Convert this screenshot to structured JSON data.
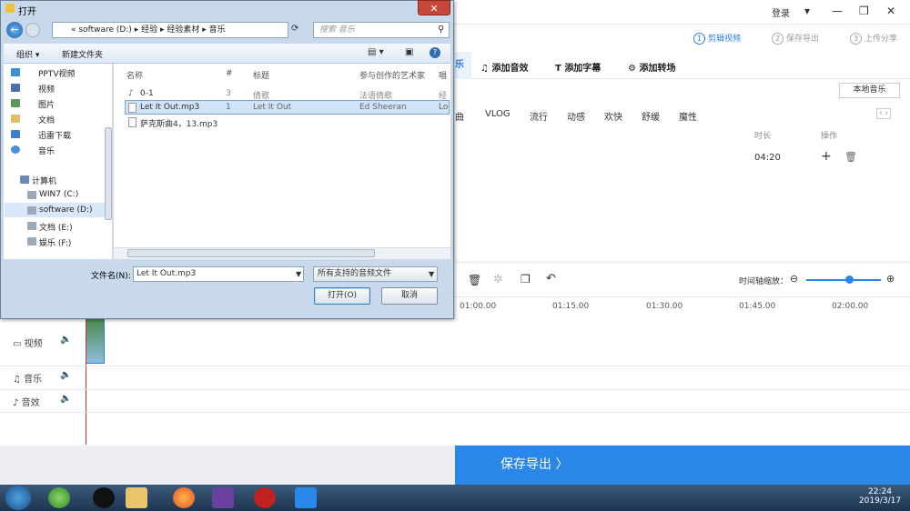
{
  "app": {
    "login": "登录",
    "steps": [
      {
        "num": "1",
        "label": "剪辑视频"
      },
      {
        "num": "2",
        "label": "保存导出"
      },
      {
        "num": "3",
        "label": "上传分享"
      }
    ],
    "tools": [
      "乐",
      "添加音效",
      "添加字幕",
      "添加转场"
    ],
    "local_music": "本地音乐",
    "categories": [
      "曲",
      "VLOG",
      "流行",
      "动感",
      "欢快",
      "舒缓",
      "魔性"
    ],
    "col_duration": "时长",
    "col_action": "操作",
    "duration_value": "04:20",
    "zoom_label": "时间轴缩放：",
    "ruler": [
      "01:00.00",
      "01:15.00",
      "01:30.00",
      "01:45.00",
      "02:00.00"
    ],
    "tracks": [
      "视频",
      "音乐",
      "音效"
    ],
    "save_export": "保存导出 〉",
    "accent": "#2a86e8"
  },
  "dialog": {
    "title": "打开",
    "breadcrumb": "« software (D:) ▸ 经验 ▸ 经验素材 ▸ 音乐",
    "search_placeholder": "搜索 音乐",
    "organize": "组织 ▾",
    "new_folder": "新建文件夹",
    "nav": [
      "PPTV视频",
      "视频",
      "图片",
      "文档",
      "迅雷下载",
      "音乐",
      "计算机",
      "WIN7 (C:)",
      "software (D:)",
      "文档 (E:)",
      "娱乐 (F:)"
    ],
    "headers": [
      "名称",
      "#",
      "标题",
      "参与创作的艺术家",
      "唱"
    ],
    "files": [
      {
        "name": "0-1",
        "num": "3",
        "title": "倩歌",
        "artist": "法语倩歌",
        "extra": "经"
      },
      {
        "name": "Let It Out.mp3",
        "num": "1",
        "title": "Let It Out",
        "artist": "Ed Sheeran",
        "extra": "Lo"
      },
      {
        "name": "萨克斯曲4，13.mp3",
        "num": "",
        "title": "",
        "artist": "",
        "extra": ""
      }
    ],
    "filename_label": "文件名(N):",
    "filename_value": "Let It Out.mp3",
    "filetype": "所有支持的音频文件",
    "open_button": "打开(O)",
    "cancel_button": "取消"
  },
  "taskbar": {
    "time": "22:24",
    "date": "2019/3/17"
  }
}
